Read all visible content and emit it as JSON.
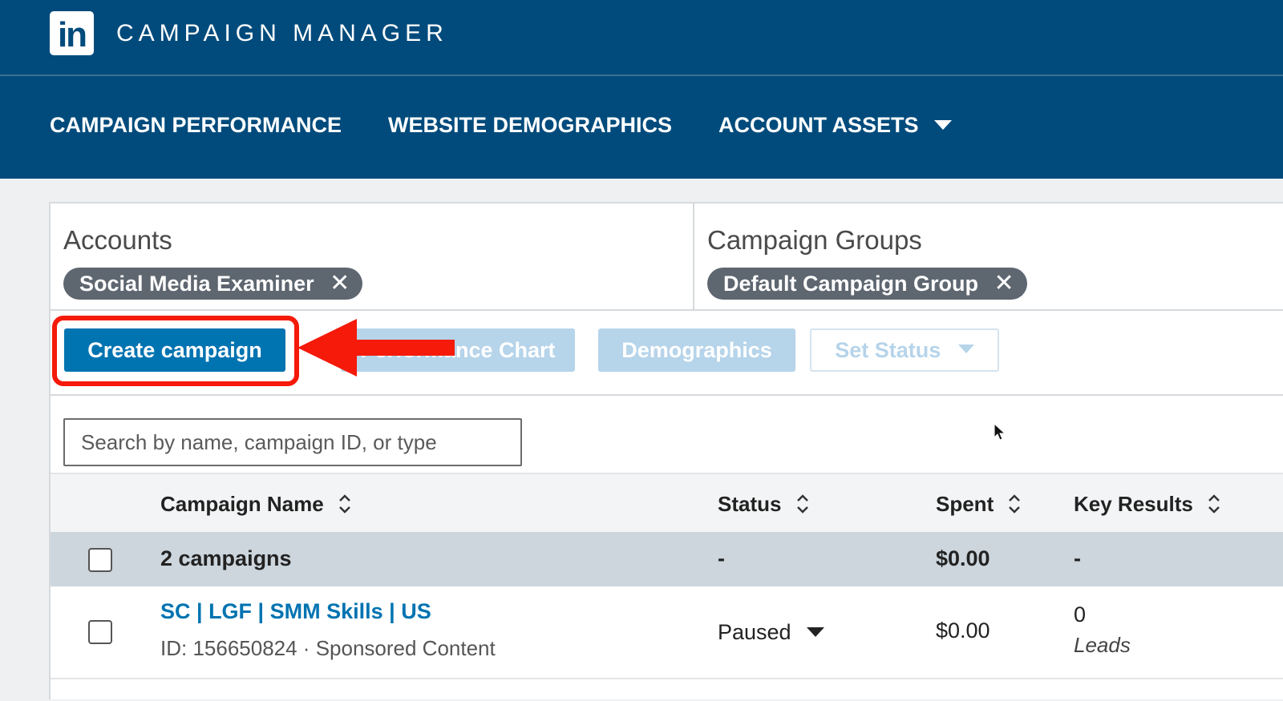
{
  "header": {
    "logo_text": "in",
    "app_title": "CAMPAIGN MANAGER"
  },
  "nav": {
    "items": [
      {
        "label": "CAMPAIGN PERFORMANCE"
      },
      {
        "label": "WEBSITE DEMOGRAPHICS"
      },
      {
        "label": "ACCOUNT ASSETS",
        "has_dropdown": true
      }
    ]
  },
  "filters": {
    "accounts": {
      "label": "Accounts",
      "chip": "Social Media Examiner"
    },
    "campaign_groups": {
      "label": "Campaign Groups",
      "chip": "Default Campaign Group"
    },
    "remove_glyph": "✕"
  },
  "actions": {
    "create_campaign": "Create campaign",
    "performance_chart": "Performance Chart",
    "demographics": "Demographics",
    "set_status": "Set Status"
  },
  "search": {
    "placeholder": "Search by name, campaign ID, or type"
  },
  "table": {
    "columns": [
      "Campaign Name",
      "Status",
      "Spent",
      "Key Results"
    ],
    "summary": {
      "name": "2 campaigns",
      "status": "-",
      "spent": "$0.00",
      "key_results": "-"
    },
    "rows": [
      {
        "name": "SC | LGF | SMM Skills | US",
        "meta": "ID: 156650824 · Sponsored Content",
        "status": "Paused",
        "spent": "$0.00",
        "key_results_value": "0",
        "key_results_label": "Leads"
      }
    ]
  },
  "colors": {
    "brand_blue": "#004b7c",
    "primary_button": "#0073b1",
    "annotation_red": "#f51a0a"
  }
}
